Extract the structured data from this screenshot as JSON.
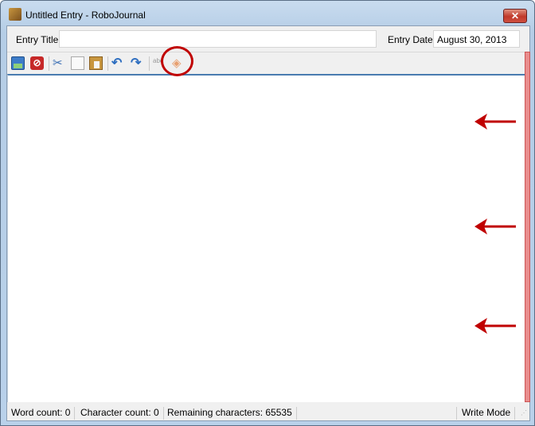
{
  "window": {
    "title": "Untitled Entry - RoboJournal",
    "close_label": "✕"
  },
  "header": {
    "entry_title_label": "Entry Title",
    "entry_title_value": "",
    "entry_date_label": "Entry Date",
    "entry_date_value": "August 30, 2013"
  },
  "toolbar": {
    "items": [
      "save-icon",
      "cancel-icon",
      "cut-icon",
      "copy-icon",
      "paste-icon",
      "undo-icon",
      "redo-icon",
      "spellcheck-icon",
      "tag-icon"
    ]
  },
  "editor": {
    "content": ""
  },
  "status": {
    "word_count": "Word count: 0",
    "character_count": "Character count: 0",
    "remaining": "Remaining characters: 65535",
    "mode": "Write Mode"
  },
  "colors": {
    "annotation": "#c00000",
    "highlight": "#e98d8d"
  }
}
